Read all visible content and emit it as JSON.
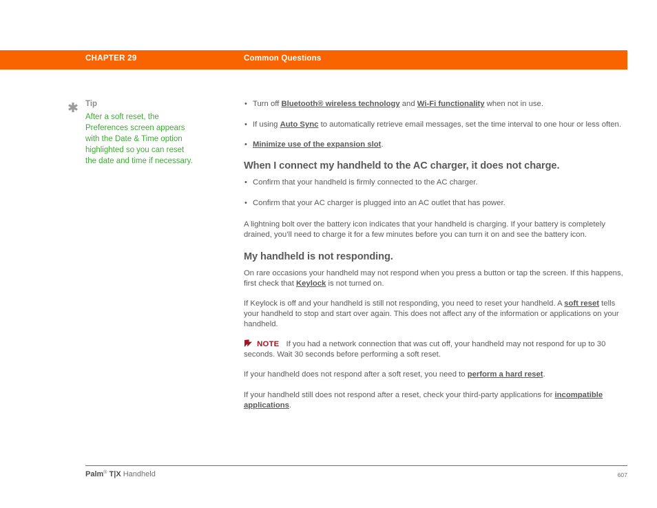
{
  "header": {
    "chapter": "CHAPTER 29",
    "title": "Common Questions",
    "bar_color": "#fa6400"
  },
  "tip": {
    "icon": "asterisk-icon",
    "label": "Tip",
    "text": "After a soft reset, the Preferences screen appears with the Date & Time option highlighted so you can reset the date and time if necessary.",
    "color": "#3eaa35"
  },
  "main": {
    "top_bullets": [
      {
        "segments": [
          {
            "t": "Turn off ",
            "style": "normal"
          },
          {
            "t": "Bluetooth® wireless technology",
            "style": "link"
          },
          {
            "t": " and ",
            "style": "normal"
          },
          {
            "t": "Wi-Fi functionality",
            "style": "link"
          },
          {
            "t": " when not in use.",
            "style": "normal"
          }
        ]
      },
      {
        "segments": [
          {
            "t": "If using ",
            "style": "normal"
          },
          {
            "t": "Auto Sync",
            "style": "link"
          },
          {
            "t": " to automatically retrieve email messages, set the time interval to one hour or less often.",
            "style": "normal"
          }
        ]
      },
      {
        "segments": [
          {
            "t": "Minimize use of the expansion slot",
            "style": "link"
          },
          {
            "t": ".",
            "style": "normal"
          }
        ]
      }
    ],
    "heading_1": "When I connect my handheld to the AC charger, it does not charge.",
    "charger_bullets": [
      {
        "segments": [
          {
            "t": "Confirm that your handheld is firmly connected to the AC charger.",
            "style": "normal"
          }
        ]
      },
      {
        "segments": [
          {
            "t": "Confirm that your AC charger is plugged into an AC outlet that has power.",
            "style": "normal"
          }
        ]
      }
    ],
    "charger_paragraph": {
      "segments": [
        {
          "t": "A lightning bolt over the battery icon indicates that your handheld is charging. If your battery is completely drained, you’ll need to charge it for a few minutes before you can turn it on and see the battery icon.",
          "style": "normal"
        }
      ]
    },
    "heading_2": "My handheld is not responding.",
    "paragraph_1": {
      "segments": [
        {
          "t": "On rare occasions your handheld may not respond when you press a button or tap the screen. If this happens, first check that ",
          "style": "normal"
        },
        {
          "t": "Keylock",
          "style": "link"
        },
        {
          "t": " is not turned on.",
          "style": "normal"
        }
      ]
    },
    "paragraph_2": {
      "segments": [
        {
          "t": "If Keylock is off and your handheld is still not responding, you need to reset your handheld. A ",
          "style": "normal"
        },
        {
          "t": "soft reset",
          "style": "link"
        },
        {
          "t": " tells your handheld to stop and start over again. This does not affect any of the information or applications on your handheld.",
          "style": "normal"
        }
      ]
    },
    "note": {
      "icon": "note-flag-icon",
      "label": "NOTE",
      "label_color": "#a31621",
      "text": "If you had a network connection that was cut off, your handheld may not respond for up to 30 seconds. Wait 30 seconds before performing a soft reset."
    },
    "paragraph_3": {
      "segments": [
        {
          "t": "If your handheld does not respond after a soft reset, you need to ",
          "style": "normal"
        },
        {
          "t": "perform a hard reset",
          "style": "link"
        },
        {
          "t": ".",
          "style": "normal"
        }
      ]
    },
    "paragraph_4": {
      "segments": [
        {
          "t": "If your handheld still does not respond after a reset, check your third-party applications for ",
          "style": "normal"
        },
        {
          "t": "incompatible applications",
          "style": "link"
        },
        {
          "t": ".",
          "style": "normal"
        }
      ]
    }
  },
  "footer": {
    "product_bold": "Palm",
    "product_sup": "®",
    "product_bold2": " T|X",
    "product_rest": " Handheld",
    "page_number": "607"
  }
}
